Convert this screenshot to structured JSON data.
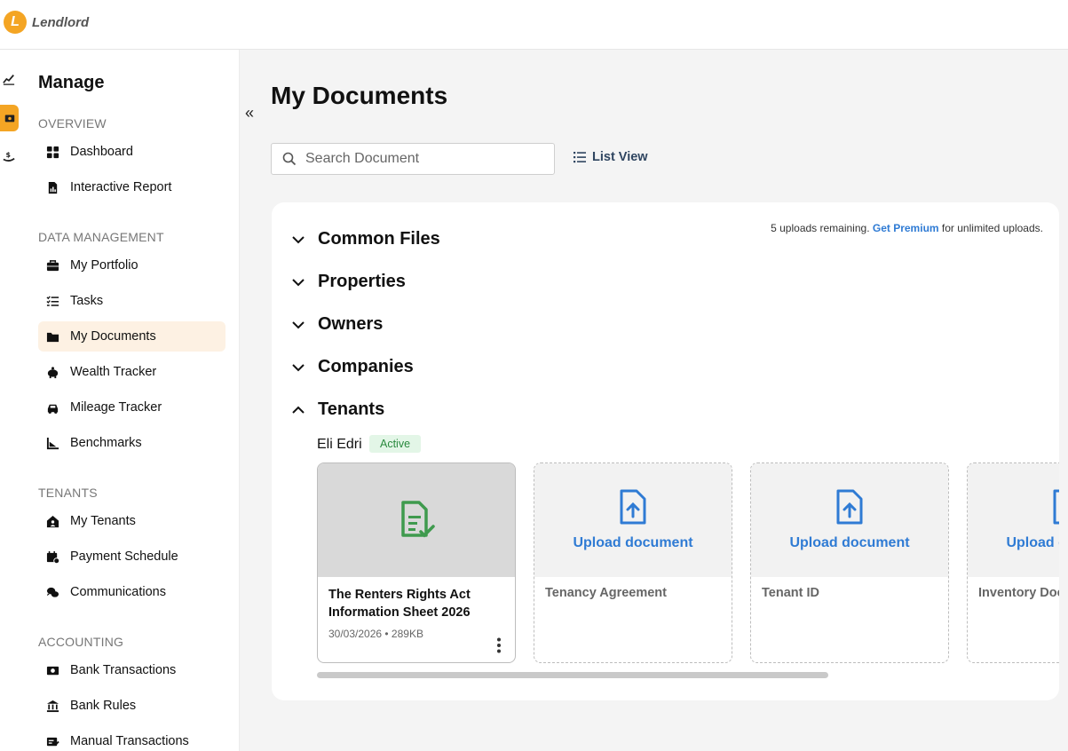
{
  "app": {
    "logo_letter": "L",
    "name": "Lendlord"
  },
  "sidebar": {
    "title": "Manage",
    "sections": [
      {
        "label": "OVERVIEW"
      },
      {
        "label": "DATA MANAGEMENT"
      },
      {
        "label": "TENANTS"
      },
      {
        "label": "ACCOUNTING"
      }
    ],
    "items": [
      {
        "label": "Dashboard",
        "icon": "dashboard-icon"
      },
      {
        "label": "Interactive Report",
        "icon": "report-icon"
      },
      {
        "label": "My Portfolio",
        "icon": "briefcase-icon"
      },
      {
        "label": "Tasks",
        "icon": "tasks-icon"
      },
      {
        "label": "My Documents",
        "icon": "folder-icon",
        "active": true
      },
      {
        "label": "Wealth Tracker",
        "icon": "piggy-bank-icon"
      },
      {
        "label": "Mileage Tracker",
        "icon": "car-icon"
      },
      {
        "label": "Benchmarks",
        "icon": "benchmark-icon"
      },
      {
        "label": "My Tenants",
        "icon": "house-user-icon"
      },
      {
        "label": "Payment Schedule",
        "icon": "calendar-icon"
      },
      {
        "label": "Communications",
        "icon": "chat-icon"
      },
      {
        "label": "Bank Transactions",
        "icon": "money-icon"
      },
      {
        "label": "Bank Rules",
        "icon": "bank-icon"
      },
      {
        "label": "Manual Transactions",
        "icon": "manual-transaction-icon"
      }
    ],
    "collapse_glyph": "«"
  },
  "main": {
    "title": "My Documents",
    "search": {
      "placeholder": "Search Document"
    },
    "list_view_label": "List View",
    "uploads_note": {
      "prefix": "5 uploads remaining.",
      "link": "Get Premium",
      "suffix": "for unlimited uploads."
    },
    "groups": [
      {
        "label": "Common Files",
        "expanded": false
      },
      {
        "label": "Properties",
        "expanded": false
      },
      {
        "label": "Owners",
        "expanded": false
      },
      {
        "label": "Companies",
        "expanded": false
      },
      {
        "label": "Tenants",
        "expanded": true
      }
    ],
    "tenant": {
      "name": "Eli Edri",
      "status": "Active"
    },
    "cards": [
      {
        "kind": "file",
        "title": "The Renters Rights Act Information Sheet 2026",
        "meta": "30/03/2026 • 289KB"
      },
      {
        "kind": "upload",
        "action": "Upload document",
        "doc_type": "Tenancy Agreement"
      },
      {
        "kind": "upload",
        "action": "Upload document",
        "doc_type": "Tenant ID"
      },
      {
        "kind": "upload",
        "action": "Upload document",
        "doc_type": "Inventory Doc"
      }
    ]
  },
  "colors": {
    "brand": "#f4a524",
    "link": "#2f7bd4",
    "active_bg": "#fdf1e3",
    "success": "#2a8a3e"
  }
}
